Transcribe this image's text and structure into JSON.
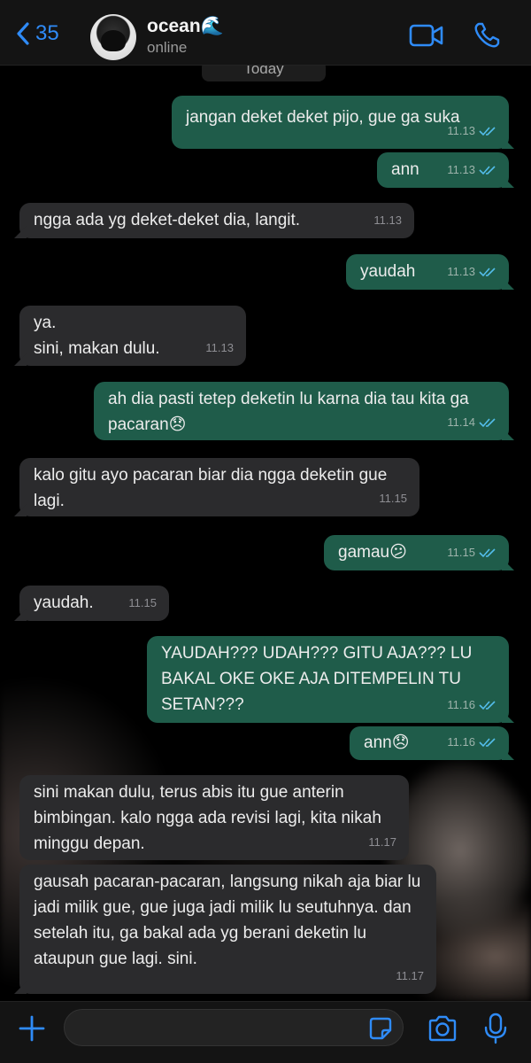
{
  "header": {
    "back_count": "35",
    "contact_name": "ocean🌊",
    "contact_status": "online"
  },
  "date_chip": "Today",
  "messages": [
    {
      "dir": "out",
      "text": "jangan deket deket pijo, gue ga suka",
      "time": "11.13",
      "read": true
    },
    {
      "dir": "out",
      "text": "ann",
      "time": "11.13",
      "read": true
    },
    {
      "dir": "in",
      "text": "ngga ada yg deket-deket dia, langit.",
      "time": "11.13"
    },
    {
      "dir": "out",
      "text": "yaudah",
      "time": "11.13",
      "read": true
    },
    {
      "dir": "in",
      "text": "ya.\nsini, makan dulu.",
      "time": "11.13"
    },
    {
      "dir": "out",
      "text": "ah dia pasti tetep deketin lu karna dia tau kita ga pacaran😞",
      "time": "11.14",
      "read": true
    },
    {
      "dir": "in",
      "text": "kalo gitu ayo pacaran biar dia ngga deketin gue lagi.",
      "time": "11.15"
    },
    {
      "dir": "out",
      "text": "gamau😕",
      "time": "11.15",
      "read": true
    },
    {
      "dir": "in",
      "text": "yaudah.",
      "time": "11.15"
    },
    {
      "dir": "out",
      "text": "YAUDAH??? UDAH??? GITU AJA??? LU BAKAL OKE OKE AJA DITEMPELIN TU SETAN???",
      "time": "11.16",
      "read": true
    },
    {
      "dir": "out",
      "text": "ann😞",
      "time": "11.16",
      "read": true
    },
    {
      "dir": "in",
      "text": "sini makan dulu, terus abis itu gue anterin bimbingan. kalo ngga ada revisi lagi, kita nikah minggu depan.",
      "time": "11.17"
    },
    {
      "dir": "in",
      "text": "gausah pacaran-pacaran, langsung nikah aja biar lu jadi milik gue, gue juga jadi milik lu seutuhnya. dan setelah itu, ga bakal ada yg berani deketin lu ataupun gue lagi. sini.",
      "time": "11.17"
    }
  ],
  "colors": {
    "accent": "#2f8bf7",
    "outgoing_bubble": "#1f5c4a",
    "incoming_bubble": "#2b2b2d",
    "read_ticks": "#53bdeb"
  },
  "icons": {
    "back": "chevron-left-icon",
    "video": "video-camera-icon",
    "call": "phone-icon",
    "attach": "plus-icon",
    "sticker": "sticker-icon",
    "camera": "camera-icon",
    "mic": "microphone-icon"
  }
}
